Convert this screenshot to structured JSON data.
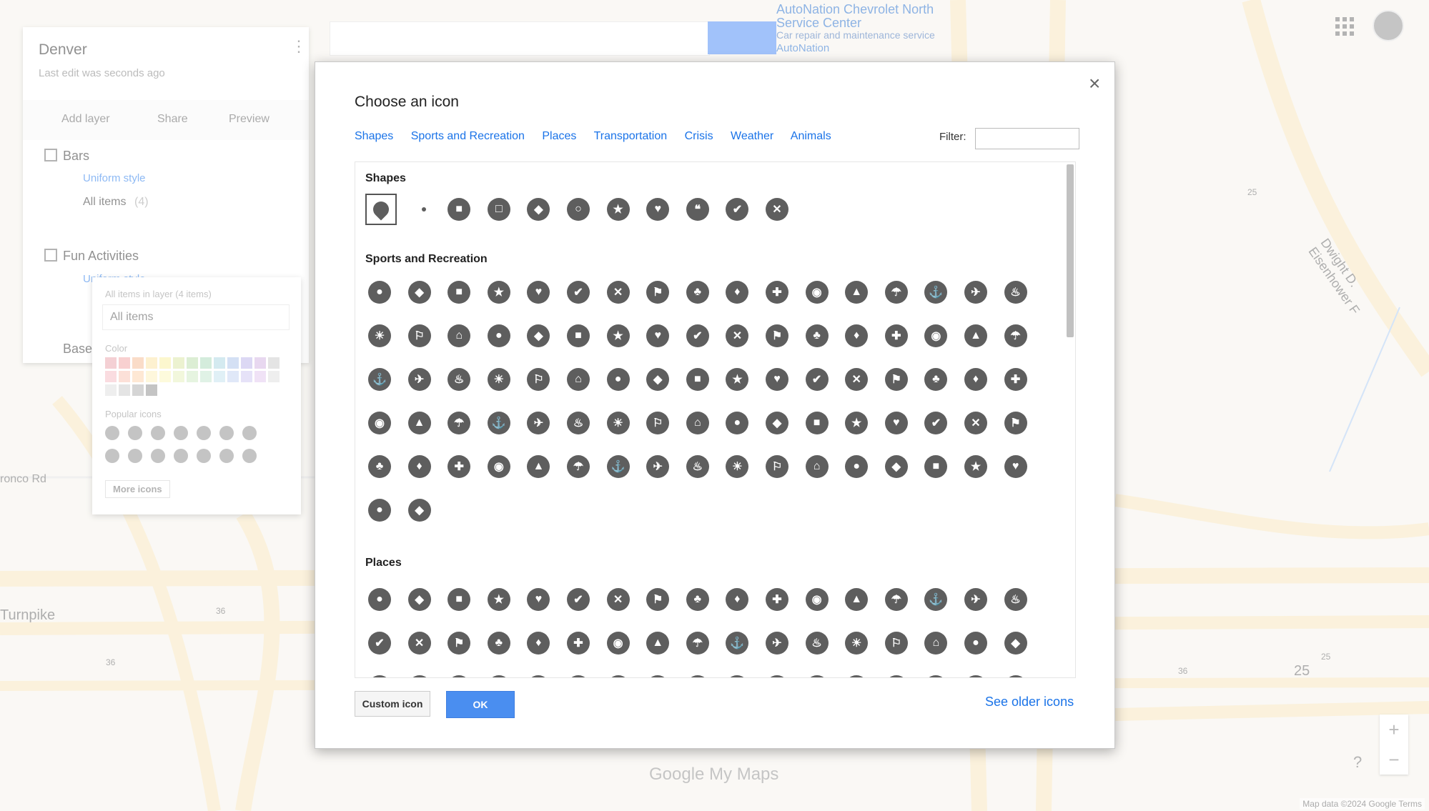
{
  "map": {
    "road_label_1": "ronco Rd",
    "road_label_2": "Turnpike",
    "road_label_3": "Dwight D. Eisenhower F",
    "highway_shields": [
      "25",
      "36",
      "36",
      "25",
      "36",
      "25"
    ],
    "poi_name": "AutoNation Chevrolet North Service Center",
    "poi_desc": "Car repair and maintenance service",
    "poi_name_2": "AutoNation",
    "brand": "Google My Maps",
    "attribution": "Map data ©2024 Google   Terms",
    "zoom_in": "+",
    "zoom_out": "−",
    "help": "?"
  },
  "panel": {
    "title": "Denver",
    "subtitle": "Last edit was seconds ago",
    "add_layer": "Add layer",
    "share": "Share",
    "preview": "Preview",
    "layer1_name": "Bars",
    "layer1_style": "Uniform style",
    "layer1_items": "All items",
    "layer1_count": "(4)",
    "layer2_name": "Fun Activities",
    "layer2_style": "Uniform style",
    "base_label": "Base"
  },
  "style_popup": {
    "header": "All items in layer   (4 items)",
    "field_value": "All items",
    "color_label": "Color",
    "popular_label": "Popular icons",
    "more_icons": "More icons"
  },
  "dialog": {
    "title": "Choose an icon",
    "close": "×",
    "tabs": [
      "Shapes",
      "Sports and Recreation",
      "Places",
      "Transportation",
      "Crisis",
      "Weather",
      "Animals"
    ],
    "filter_label": "Filter:",
    "filter_value": "",
    "sections": {
      "shapes": "Shapes",
      "sports": "Sports and Recreation",
      "places": "Places"
    },
    "custom_icon": "Custom icon",
    "ok": "OK",
    "see_older": "See older icons"
  },
  "colors": {
    "accent": "#1a73e8",
    "ok_button": "#4a8ef0",
    "icon_fill": "#5e5e5e"
  }
}
